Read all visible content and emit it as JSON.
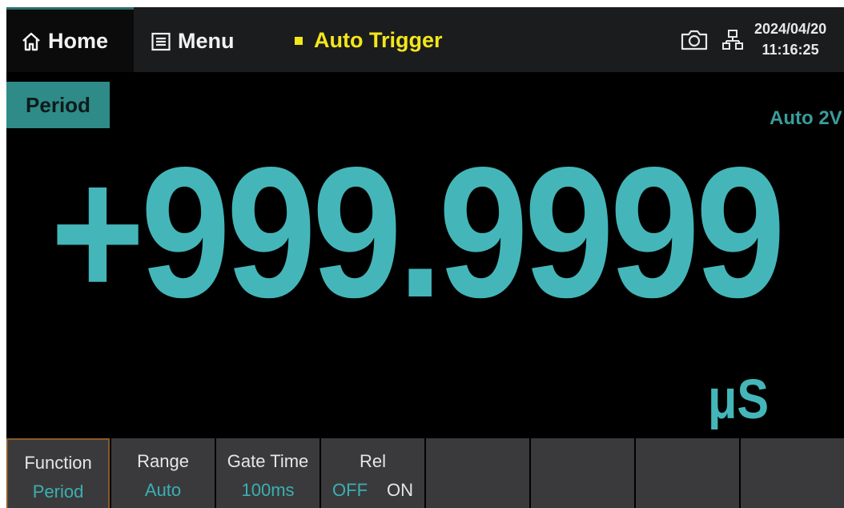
{
  "topbar": {
    "home_label": "Home",
    "menu_label": "Menu",
    "trigger_label": "Auto Trigger",
    "date": "2024/04/20",
    "time": "11:16:25"
  },
  "measurement": {
    "function": "Period",
    "range_indicator": "Auto 2V",
    "value": "+999.9999",
    "unit": "μS"
  },
  "softkeys": [
    {
      "title": "Function",
      "value": "Period"
    },
    {
      "title": "Range",
      "value": "Auto"
    },
    {
      "title": "Gate Time",
      "value": "100ms"
    },
    {
      "title": "Rel",
      "off": "OFF",
      "on": "ON",
      "selected": "OFF"
    }
  ],
  "colors": {
    "accent": "#44b6b9",
    "trigger": "#f3e71a",
    "function_tag": "#2e8b88"
  },
  "icons": [
    "home-icon",
    "menu-icon",
    "camera-icon",
    "network-icon"
  ]
}
